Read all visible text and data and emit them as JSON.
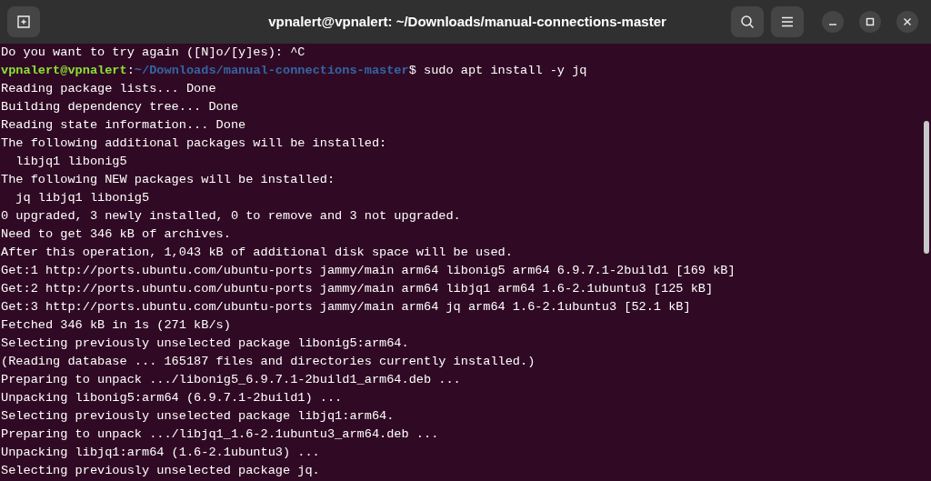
{
  "window": {
    "title": "vpnalert@vpnalert: ~/Downloads/manual-connections-master"
  },
  "lines": [
    {
      "kind": "output",
      "text": "Do you want to try again ([N]o/[y]es): ^C"
    },
    {
      "kind": "prompt",
      "user": "vpnalert@vpnalert",
      "separator": ":",
      "path": "~/Downloads/manual-connections-master",
      "command": "$ sudo apt install -y jq"
    },
    {
      "kind": "output",
      "text": "Reading package lists... Done"
    },
    {
      "kind": "output",
      "text": "Building dependency tree... Done"
    },
    {
      "kind": "output",
      "text": "Reading state information... Done"
    },
    {
      "kind": "output",
      "text": "The following additional packages will be installed:"
    },
    {
      "kind": "output",
      "text": "  libjq1 libonig5"
    },
    {
      "kind": "output",
      "text": "The following NEW packages will be installed:"
    },
    {
      "kind": "output",
      "text": "  jq libjq1 libonig5"
    },
    {
      "kind": "output",
      "text": "0 upgraded, 3 newly installed, 0 to remove and 3 not upgraded."
    },
    {
      "kind": "output",
      "text": "Need to get 346 kB of archives."
    },
    {
      "kind": "output",
      "text": "After this operation, 1,043 kB of additional disk space will be used."
    },
    {
      "kind": "output",
      "text": "Get:1 http://ports.ubuntu.com/ubuntu-ports jammy/main arm64 libonig5 arm64 6.9.7.1-2build1 [169 kB]"
    },
    {
      "kind": "output",
      "text": "Get:2 http://ports.ubuntu.com/ubuntu-ports jammy/main arm64 libjq1 arm64 1.6-2.1ubuntu3 [125 kB]"
    },
    {
      "kind": "output",
      "text": "Get:3 http://ports.ubuntu.com/ubuntu-ports jammy/main arm64 jq arm64 1.6-2.1ubuntu3 [52.1 kB]"
    },
    {
      "kind": "output",
      "text": "Fetched 346 kB in 1s (271 kB/s)"
    },
    {
      "kind": "output",
      "text": "Selecting previously unselected package libonig5:arm64."
    },
    {
      "kind": "output",
      "text": "(Reading database ... 165187 files and directories currently installed.)"
    },
    {
      "kind": "output",
      "text": "Preparing to unpack .../libonig5_6.9.7.1-2build1_arm64.deb ..."
    },
    {
      "kind": "output",
      "text": "Unpacking libonig5:arm64 (6.9.7.1-2build1) ..."
    },
    {
      "kind": "output",
      "text": "Selecting previously unselected package libjq1:arm64."
    },
    {
      "kind": "output",
      "text": "Preparing to unpack .../libjq1_1.6-2.1ubuntu3_arm64.deb ..."
    },
    {
      "kind": "output",
      "text": "Unpacking libjq1:arm64 (1.6-2.1ubuntu3) ..."
    },
    {
      "kind": "output",
      "text": "Selecting previously unselected package jq."
    }
  ]
}
